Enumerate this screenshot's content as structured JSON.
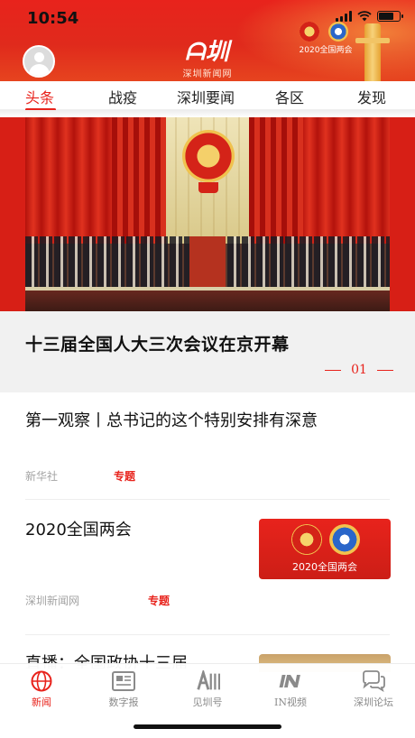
{
  "status_bar": {
    "time": "10:54"
  },
  "header": {
    "logo_main": "ᗩ圳",
    "logo_sub": "深圳新闻网",
    "badge_text": "2020全国两会"
  },
  "tabs": [
    {
      "label": "头条",
      "active": true
    },
    {
      "label": "战疫",
      "active": false
    },
    {
      "label": "深圳要闻",
      "active": false
    },
    {
      "label": "各区",
      "active": false
    },
    {
      "label": "发现",
      "active": false
    }
  ],
  "hero": {
    "title": "十三届全国人大三次会议在京开幕",
    "index": "01"
  },
  "articles": [
    {
      "title": "第一观察丨总书记的这个特别安排有深意",
      "source": "新华社",
      "tag": "专题"
    },
    {
      "title": "2020全国两会",
      "source": "深圳新闻网",
      "tag": "专题",
      "thumb_text": "2020全国两会"
    },
    {
      "title": "直播：全国政协十三届"
    }
  ],
  "bottom_nav": [
    {
      "label": "新闻",
      "icon": "globe-icon",
      "active": true
    },
    {
      "label": "数字报",
      "icon": "newspaper-icon",
      "active": false
    },
    {
      "label": "见圳号",
      "icon": "jianzhen-logo-icon",
      "active": false
    },
    {
      "label": "IN视频",
      "icon": "in-video-icon",
      "active": false
    },
    {
      "label": "深圳论坛",
      "icon": "chat-bubbles-icon",
      "active": false
    }
  ],
  "colors": {
    "brand_red": "#e8231c",
    "muted_text": "#a3a3a3"
  }
}
